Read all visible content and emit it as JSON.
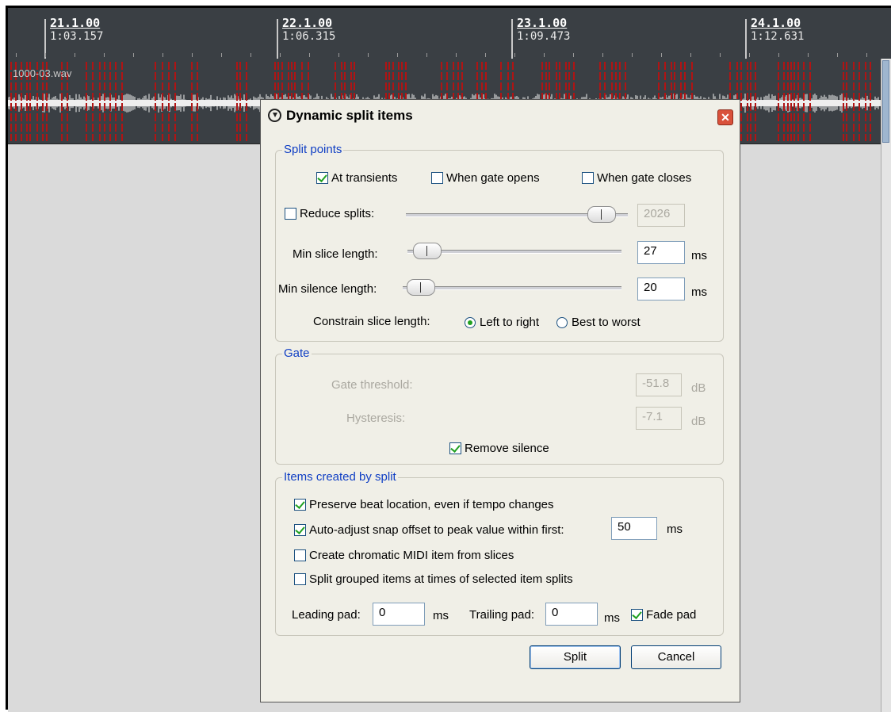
{
  "ruler": {
    "marks": [
      {
        "bar": "21.1.00",
        "time": "1:03.157"
      },
      {
        "bar": "22.1.00",
        "time": "1:06.315"
      },
      {
        "bar": "23.1.00",
        "time": "1:09.473"
      },
      {
        "bar": "24.1.00",
        "time": "1:12.631"
      }
    ]
  },
  "track": {
    "item_name": "1000-03.wav"
  },
  "dialog": {
    "title": "Dynamic split items",
    "close_glyph": "✕",
    "split_points": {
      "legend": "Split points",
      "at_transients": {
        "label": "At transients",
        "checked": true
      },
      "gate_opens": {
        "label": "When gate opens",
        "checked": false
      },
      "gate_closes": {
        "label": "When gate closes",
        "checked": false
      },
      "reduce_splits": {
        "label": "Reduce splits:",
        "checked": false,
        "value": "2026",
        "slider_level": 0.94
      },
      "min_slice": {
        "label": "Min slice length:",
        "value": "27",
        "unit": "ms",
        "slider_level": 0.03
      },
      "min_silence": {
        "label": "Min silence length:",
        "value": "20",
        "unit": "ms",
        "slider_level": 0.02
      },
      "constrain": {
        "label": "Constrain slice length:",
        "left_to_right": "Left to right",
        "best_to_worst": "Best to worst",
        "selected": "left_to_right"
      }
    },
    "gate": {
      "legend": "Gate",
      "threshold": {
        "label": "Gate threshold:",
        "value": "-51.8",
        "unit": "dB"
      },
      "hysteresis": {
        "label": "Hysteresis:",
        "value": "-7.1",
        "unit": "dB"
      },
      "remove_silence": {
        "label": "Remove silence",
        "checked": true
      }
    },
    "items": {
      "legend": "Items created by split",
      "preserve_beat": {
        "label": "Preserve beat location, even if tempo changes",
        "checked": true
      },
      "auto_adjust": {
        "label": "Auto-adjust snap offset to peak value within first:",
        "checked": true,
        "value": "50",
        "unit": "ms"
      },
      "chromatic_midi": {
        "label": "Create chromatic MIDI item from slices",
        "checked": false
      },
      "split_grouped": {
        "label": "Split grouped items at times of selected item splits",
        "checked": false
      },
      "leading_pad": {
        "label": "Leading pad:",
        "value": "0",
        "unit": "ms"
      },
      "trailing_pad": {
        "label": "Trailing pad:",
        "value": "0",
        "unit": "ms"
      },
      "fade_pad": {
        "label": "Fade pad",
        "checked": true
      }
    },
    "buttons": {
      "split": "Split",
      "cancel": "Cancel"
    }
  }
}
